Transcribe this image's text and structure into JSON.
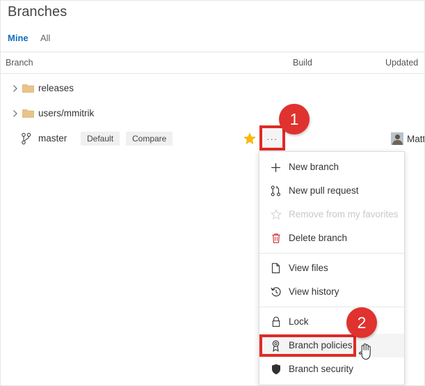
{
  "page": {
    "title": "Branches"
  },
  "tabs": [
    {
      "label": "Mine",
      "active": true
    },
    {
      "label": "All",
      "active": false
    }
  ],
  "columns": {
    "branch": "Branch",
    "build": "Build",
    "updated": "Updated"
  },
  "rows": [
    {
      "name": "releases",
      "type": "folder",
      "icon": "folder-icon",
      "expandable": true
    },
    {
      "name": "users/mmitrik",
      "type": "folder",
      "icon": "folder-icon",
      "expandable": true
    },
    {
      "name": "master",
      "type": "branch",
      "icon": "branch-icon",
      "expandable": false
    }
  ],
  "master_row": {
    "default_pill": "Default",
    "compare_pill": "Compare",
    "favorite_icon": "star-filled-icon",
    "more_icon": "ellipsis-icon",
    "more_label": "...",
    "author": "Matt",
    "avatar_icon": "avatar-icon"
  },
  "context_menu": {
    "items": [
      {
        "label": "New branch",
        "icon": "plus-icon",
        "disabled": false,
        "hovered": false,
        "separator_after": false
      },
      {
        "label": "New pull request",
        "icon": "pull-request-icon",
        "disabled": false,
        "hovered": false,
        "separator_after": false
      },
      {
        "label": "Remove from my favorites",
        "icon": "star-outline-icon",
        "disabled": true,
        "hovered": false,
        "separator_after": false
      },
      {
        "label": "Delete branch",
        "icon": "trash-icon",
        "disabled": false,
        "hovered": false,
        "separator_after": true
      },
      {
        "label": "View files",
        "icon": "file-icon",
        "disabled": false,
        "hovered": false,
        "separator_after": false
      },
      {
        "label": "View history",
        "icon": "history-icon",
        "disabled": false,
        "hovered": false,
        "separator_after": true
      },
      {
        "label": "Lock",
        "icon": "lock-icon",
        "disabled": false,
        "hovered": false,
        "separator_after": false
      },
      {
        "label": "Branch policies",
        "icon": "policy-ribbon-icon",
        "disabled": false,
        "hovered": true,
        "separator_after": false
      },
      {
        "label": "Branch security",
        "icon": "shield-icon",
        "disabled": false,
        "hovered": false,
        "separator_after": false
      }
    ]
  },
  "annotations": {
    "step_1": "1",
    "step_2": "2",
    "highlight_color": "#e02a26",
    "badge_color": "#e0322f"
  },
  "colors": {
    "accent": "#106ebe",
    "folder": "#e8c48a",
    "star": "#ffb900",
    "danger": "#d13438",
    "text": "#333333"
  }
}
